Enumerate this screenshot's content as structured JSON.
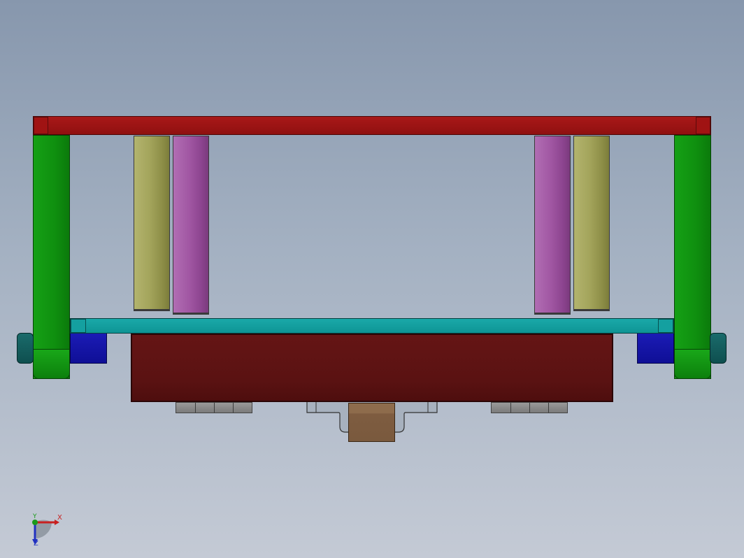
{
  "scene": {
    "description_colors": {
      "background_top": "#8797ad",
      "background_bottom": "#c4cad5",
      "top_beam": "#9c1515",
      "legs": "#129512",
      "roller_olive": "#a3a45b",
      "roller_purple": "#a157a3",
      "plate": "#129c9c",
      "blue_blocks": "#1313a5",
      "end_pins": "#135c5c",
      "housing": "#5a1212",
      "hinges": "#8a8a8a",
      "brown_block": "#825f42"
    }
  },
  "triad": {
    "x_label": "X",
    "y_label": "Y",
    "z_label": "Z",
    "x_color": "#c82020",
    "y_color": "#1a9a1a",
    "z_color": "#2030c0"
  }
}
